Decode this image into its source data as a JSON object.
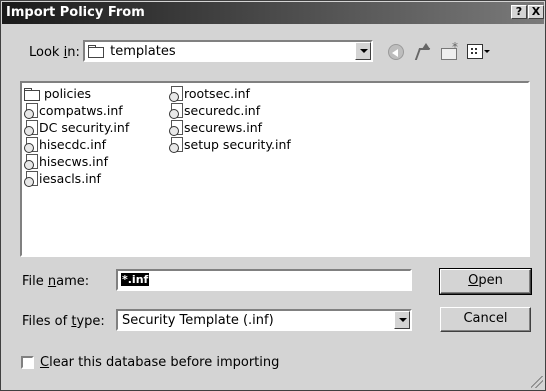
{
  "window": {
    "title": "Import Policy From",
    "help_btn": "?",
    "close_btn": "X"
  },
  "look_in": {
    "label_pre": "Look ",
    "label_key": "i",
    "label_post": "n:",
    "value": "templates",
    "icons": [
      "back-icon",
      "up-folder-icon",
      "new-folder-icon",
      "views-icon"
    ]
  },
  "files": {
    "column1": [
      {
        "name": "policies",
        "icon": "folder-icon"
      },
      {
        "name": "compatws.inf",
        "icon": "inf-file-icon"
      },
      {
        "name": "DC security.inf",
        "icon": "inf-file-icon"
      },
      {
        "name": "hisecdc.inf",
        "icon": "inf-file-icon"
      },
      {
        "name": "hisecws.inf",
        "icon": "inf-file-icon"
      },
      {
        "name": "iesacls.inf",
        "icon": "inf-file-icon"
      }
    ],
    "column2": [
      {
        "name": "rootsec.inf",
        "icon": "inf-file-icon"
      },
      {
        "name": "securedc.inf",
        "icon": "inf-file-icon"
      },
      {
        "name": "securews.inf",
        "icon": "inf-file-icon"
      },
      {
        "name": "setup security.inf",
        "icon": "inf-file-icon"
      }
    ]
  },
  "file_name": {
    "label_pre": "File ",
    "label_key": "n",
    "label_post": "ame:",
    "value": "*.inf"
  },
  "file_type": {
    "label_pre": "Files of ",
    "label_key": "t",
    "label_post": "ype:",
    "value": "Security Template (.inf)"
  },
  "buttons": {
    "open_key": "O",
    "open_rest": "pen",
    "cancel": "Cancel"
  },
  "checkbox": {
    "label_key": "C",
    "label_rest": "lear this database before importing",
    "checked": false
  }
}
